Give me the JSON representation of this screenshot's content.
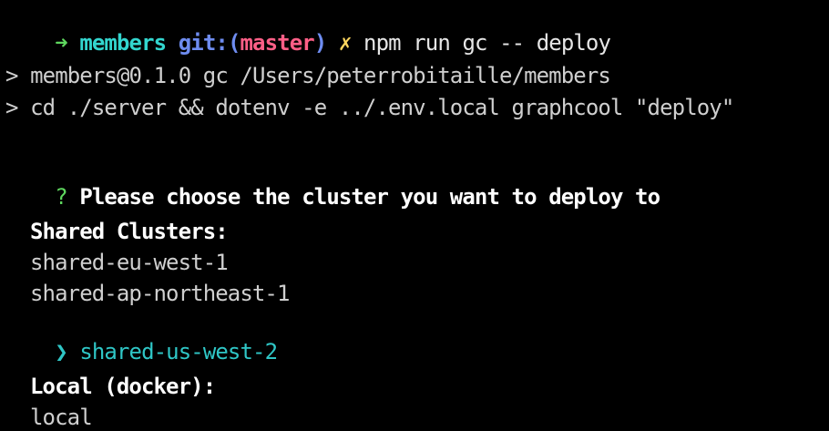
{
  "window": {
    "background": "#000000",
    "accent_cyan": "#2fc6c6",
    "prompt_green": "#5fd75f",
    "branch_red": "#ff5f87",
    "git_blue": "#6e8cf0",
    "dirty_yellow": "#ffd75f"
  },
  "prompt": {
    "arrow": "➜",
    "directory": "members",
    "git_label": "git:(",
    "branch": "master",
    "git_close": ")",
    "dirty_marker": "✗",
    "command": "npm run gc -- deploy"
  },
  "output": {
    "script_line": "> members@0.1.0 gc /Users/peterrobitaille/members",
    "script_command": "> cd ./server && dotenv -e ../.env.local graphcool \"deploy\""
  },
  "question": {
    "marker": "?",
    "text": "Please choose the cluster you want to deploy to"
  },
  "shared_clusters": {
    "heading": "Shared Clusters:",
    "options": [
      "shared-eu-west-1",
      "shared-ap-northeast-1",
      "shared-us-west-2"
    ],
    "selected_pointer": "❯"
  },
  "local_clusters": {
    "heading": "Local (docker):",
    "options": [
      "local"
    ]
  }
}
